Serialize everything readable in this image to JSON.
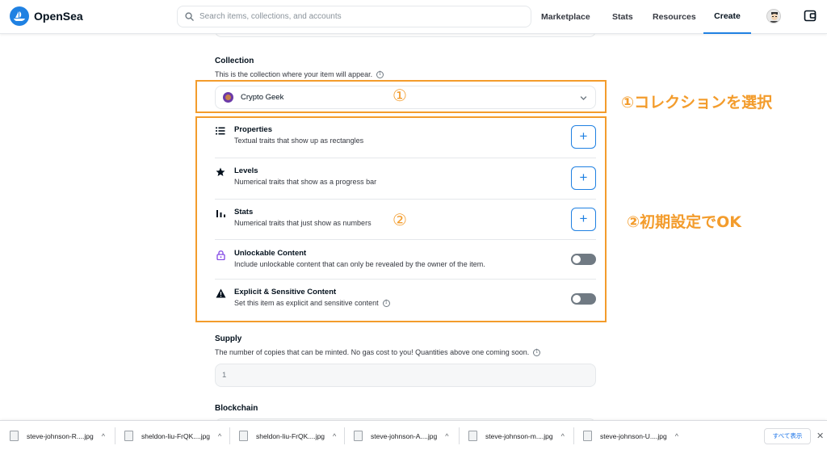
{
  "header": {
    "logo_text": "OpenSea",
    "search_placeholder": "Search items, collections, and accounts",
    "nav": {
      "marketplace": "Marketplace",
      "stats": "Stats",
      "resources": "Resources",
      "create": "Create"
    },
    "active_nav": "Create",
    "accent_color": "#2081e2"
  },
  "form": {
    "collection": {
      "title": "Collection",
      "subtitle": "This is the collection where your item will appear.",
      "selected": "Crypto Geek"
    },
    "traits": [
      {
        "title": "Properties",
        "subtitle": "Textual traits that show up as rectangles",
        "icon": "list-icon",
        "control": "add-button",
        "control_label": "+"
      },
      {
        "title": "Levels",
        "subtitle": "Numerical traits that show as a progress bar",
        "icon": "star-icon",
        "control": "add-button",
        "control_label": "+"
      },
      {
        "title": "Stats",
        "subtitle": "Numerical traits that just show as numbers",
        "icon": "bar-chart-icon",
        "control": "add-button",
        "control_label": "+"
      },
      {
        "title": "Unlockable Content",
        "subtitle": "Include unlockable content that can only be revealed by the owner of the item.",
        "icon": "lock-icon",
        "control": "toggle",
        "toggle_on": false
      },
      {
        "title": "Explicit & Sensitive Content",
        "subtitle": "Set this item as explicit and sensitive content",
        "icon": "warning-icon",
        "control": "toggle",
        "toggle_on": false
      }
    ],
    "supply": {
      "title": "Supply",
      "subtitle": "The number of copies that can be minted. No gas cost to you! Quantities above one coming soon.",
      "value": "1"
    },
    "blockchain": {
      "title": "Blockchain"
    }
  },
  "annotations": {
    "one": {
      "number": "①",
      "label": "①コレクションを選択"
    },
    "two": {
      "number": "②",
      "label": "②初期設定でOK"
    },
    "color": "#f39c2c"
  },
  "downloads": {
    "files": [
      "steve-johnson-R....jpg",
      "sheldon-liu-FrQK....jpg",
      "sheldon-liu-FrQK....jpg",
      "steve-johnson-A....jpg",
      "steve-johnson-m....jpg",
      "steve-johnson-U....jpg"
    ],
    "show_all": "すべて表示",
    "expand_glyph": "^",
    "close_glyph": "✕"
  }
}
